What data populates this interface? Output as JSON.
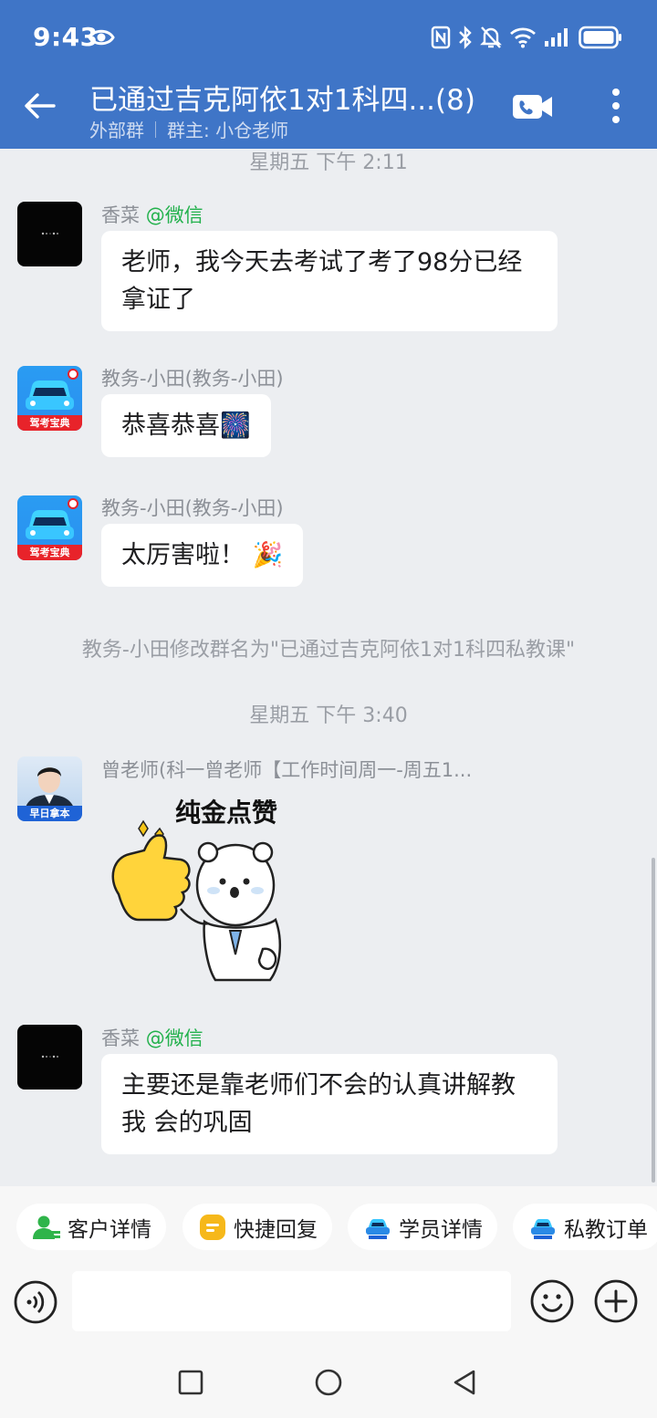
{
  "status_bar": {
    "time": "9:43",
    "icons": [
      "eye-icon",
      "nfc-icon",
      "bluetooth-icon",
      "mute-icon",
      "wifi-icon",
      "signal-icon",
      "battery-icon"
    ]
  },
  "header": {
    "title": "已通过吉克阿依1对1科四...(8)",
    "subtitle_type": "外部群",
    "subtitle_owner": "群主: 小仓老师",
    "accent_color": "#3f75c7"
  },
  "messages": [
    {
      "type": "time",
      "text": "星期五  下午 2:11"
    },
    {
      "type": "text",
      "sender": "香菜",
      "sender_tag": "@微信",
      "avatar": "dark-avatar",
      "text": "老师，我今天去考试了考了98分已经拿证了"
    },
    {
      "type": "text",
      "sender": "教务-小田(教务-小田)",
      "avatar": "car-avatar",
      "avatar_banner": "驾考宝典",
      "text": "恭喜恭喜🎆"
    },
    {
      "type": "text",
      "sender": "教务-小田(教务-小田)",
      "avatar": "car-avatar",
      "avatar_banner": "驾考宝典",
      "text": "太厉害啦！ 🎉"
    },
    {
      "type": "system",
      "text": "教务-小田修改群名为\"已通过吉克阿依1对1科四私教课\""
    },
    {
      "type": "time",
      "text": "星期五  下午 3:40"
    },
    {
      "type": "sticker",
      "sender": "曾老师(科一曾老师【工作时间周一-周五1...",
      "avatar": "person-avatar",
      "avatar_banner": "早日拿本",
      "sticker_text": "纯金点赞"
    },
    {
      "type": "text",
      "sender": "香菜",
      "sender_tag": "@微信",
      "avatar": "dark-avatar",
      "text": "主要还是靠老师们不会的认真讲解教我  会的巩固"
    }
  ],
  "quick_actions": [
    {
      "label": "客户详情",
      "icon": "customer-icon"
    },
    {
      "label": "快捷回复",
      "icon": "quick-reply-icon"
    },
    {
      "label": "学员详情",
      "icon": "student-icon"
    },
    {
      "label": "私教订单",
      "icon": "order-icon"
    }
  ],
  "input": {
    "placeholder": ""
  },
  "nav": [
    "recents-icon",
    "home-icon",
    "back-icon"
  ]
}
